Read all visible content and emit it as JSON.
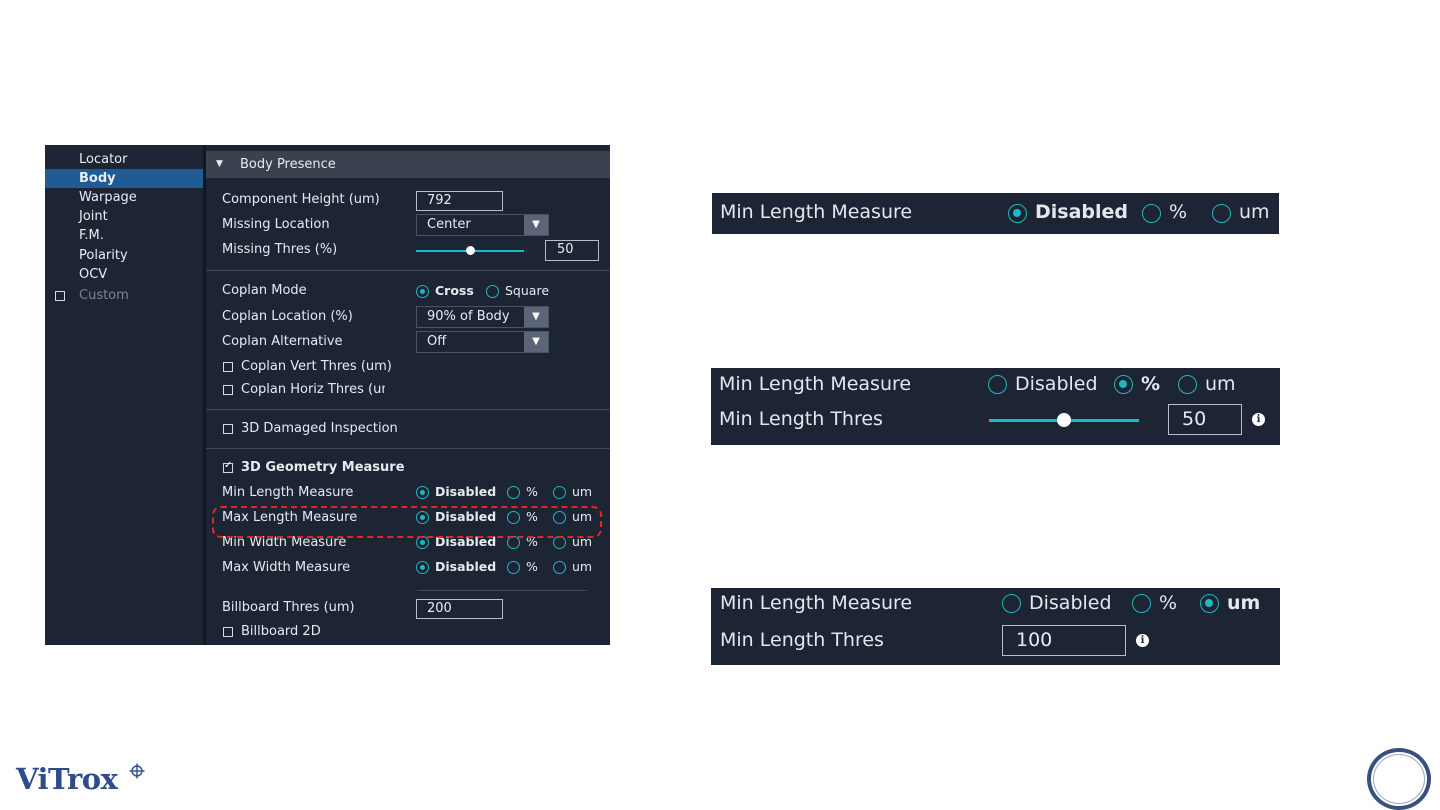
{
  "nav": {
    "items": [
      "Locator",
      "Body",
      "Warpage",
      "Joint",
      "F.M.",
      "Polarity",
      "OCV",
      "Custom"
    ],
    "selected": "Body"
  },
  "section": {
    "title": "Body Presence"
  },
  "body_presence": {
    "component_height_label": "Component Height (um)",
    "component_height_value": "792",
    "missing_location_label": "Missing Location",
    "missing_location_value": "Center",
    "missing_thres_label": "Missing Thres (%)",
    "missing_thres_value": "50",
    "missing_thres_level": 0.5
  },
  "coplan": {
    "mode_label": "Coplan Mode",
    "mode_options": [
      "Cross",
      "Square"
    ],
    "mode_selected": "Cross",
    "location_label": "Coplan Location (%)",
    "location_value": "90% of Body",
    "alternative_label": "Coplan Alternative",
    "alternative_value": "Off",
    "vert_thres_label": "Coplan Vert Thres (um)",
    "horiz_thres_label": "Coplan Horiz Thres (um"
  },
  "damaged": {
    "label": "3D Damaged Inspection"
  },
  "geometry": {
    "label": "3D Geometry Measure",
    "checked": true,
    "options": [
      "Disabled",
      "%",
      "um"
    ],
    "rows": [
      {
        "label": "Min Length Measure",
        "selected": "Disabled"
      },
      {
        "label": "Max Length Measure",
        "selected": "Disabled"
      },
      {
        "label": "Min Width Measure",
        "selected": "Disabled"
      },
      {
        "label": "Max Width Measure",
        "selected": "Disabled"
      }
    ]
  },
  "billboard": {
    "thres_label": "Billboard Thres (um)",
    "thres_value": "200",
    "twod_label": "Billboard 2D"
  },
  "zoom": {
    "measure_label": "Min Length Measure",
    "thres_label": "Min Length Thres",
    "options": [
      "Disabled",
      "%",
      "um"
    ],
    "panel1_selected": "Disabled",
    "panel2_selected": "%",
    "panel2_thres_value": "50",
    "panel2_thres_level": 0.5,
    "panel3_selected": "um",
    "panel3_thres_value": "100",
    "info_symbol": "i"
  },
  "logo": {
    "text": "ViTrox"
  },
  "colors": {
    "accent": "#1fb7c4",
    "panel_bg": "#1d2433",
    "selection": "#1f5b95",
    "highlight": "#e02626",
    "logo": "#2e4c8c"
  }
}
